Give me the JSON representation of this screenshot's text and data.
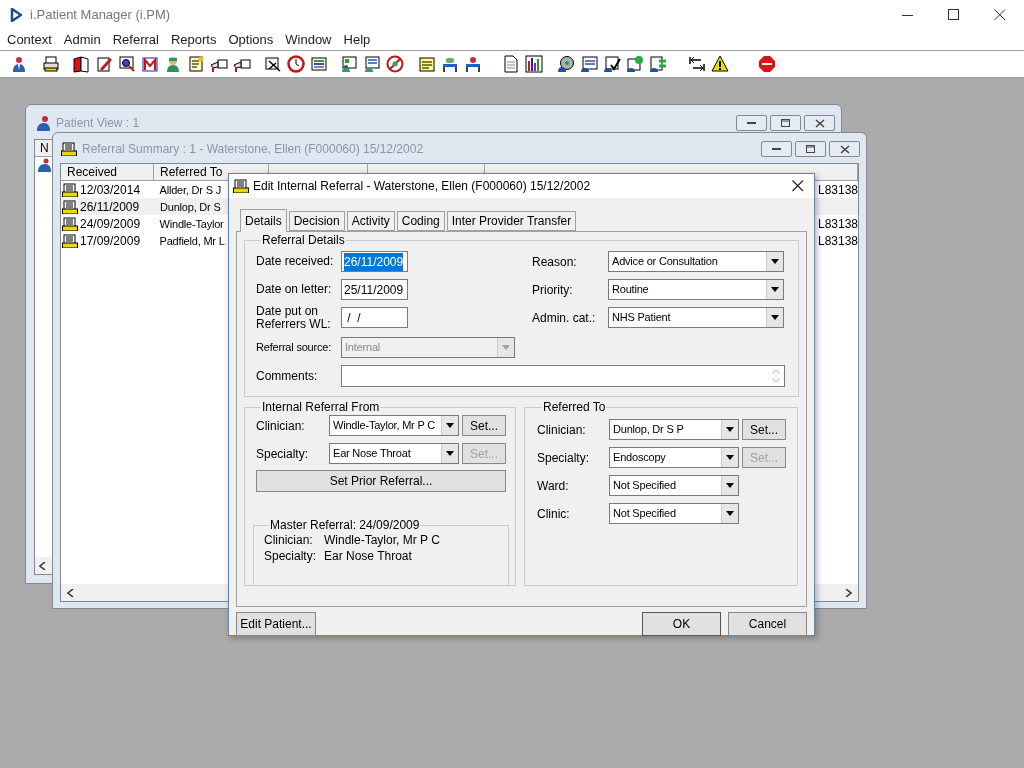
{
  "app": {
    "title": "i.Patient Manager (i.PM)"
  },
  "menu": [
    "Context",
    "Admin",
    "Referral",
    "Reports",
    "Options",
    "Window",
    "Help"
  ],
  "patient_view": {
    "title": "Patient View : 1",
    "column_1": "N"
  },
  "referral_summary": {
    "title": "Referral Summary : 1 - Waterstone, Ellen (F000060) 15/12/2002",
    "columns": [
      "Received",
      "Referred To"
    ],
    "rows": [
      {
        "received": "12/03/2014",
        "referred_to": "Allder, Dr S J",
        "health_org": "L83138",
        "selected": false
      },
      {
        "received": "26/11/2009",
        "referred_to": "Dunlop, Dr S",
        "selected": true
      },
      {
        "received": "24/09/2009",
        "referred_to": "Windle-Taylor",
        "health_org": "L83138",
        "selected": false
      },
      {
        "received": "17/09/2009",
        "referred_to": "Padfield, Mr L",
        "health_org": "L83138",
        "selected": false
      }
    ]
  },
  "dialog": {
    "title": "Edit Internal Referral - Waterstone, Ellen (F000060) 15/12/2002",
    "tabs": [
      {
        "label": "Details",
        "selected": true
      },
      {
        "label": "Decision",
        "selected": false
      },
      {
        "label": "Activity",
        "selected": false
      },
      {
        "label": "Coding",
        "selected": false
      },
      {
        "label": "Inter Provider Transfer",
        "selected": false
      }
    ],
    "referral_details": {
      "label": "Referral Details",
      "dates": [
        {
          "label": "Date received:",
          "value": "26/11/2009",
          "highlighted": true
        },
        {
          "label": "Date on letter:",
          "value": "25/11/2009",
          "highlighted": false
        },
        {
          "label": "Date put on Referrers WL:",
          "value": " /  /",
          "highlighted": false
        }
      ],
      "combos": [
        {
          "label": "Reason:",
          "value": "Advice or Consultation"
        },
        {
          "label": "Priority:",
          "value": "Routine"
        },
        {
          "label": "Admin. cat.:",
          "value": "NHS Patient"
        }
      ],
      "source": {
        "label": "Referral source:",
        "value": "Internal",
        "disabled": true
      },
      "comments": {
        "label": "Comments:"
      }
    },
    "from": {
      "label": "Internal Referral From",
      "rows": [
        {
          "label": "Clinician:",
          "value": "Windle-Taylor, Mr P C",
          "button": {
            "label": "Set...",
            "disabled": false
          }
        },
        {
          "label": "Specialty:",
          "value": "Ear Nose Throat",
          "button": {
            "label": "Set...",
            "disabled": true
          }
        }
      ],
      "prior_button": "Set Prior Referral...",
      "master": {
        "label": "Master Referral: 24/09/2009",
        "rows": [
          {
            "label": "Clinician:",
            "value": "Windle-Taylor, Mr P C"
          },
          {
            "label": "Specialty:",
            "value": "Ear Nose Throat"
          }
        ]
      }
    },
    "to": {
      "label": "Referred To",
      "rows": [
        {
          "label": "Clinician:",
          "value": "Dunlop, Dr S P",
          "button": {
            "label": "Set...",
            "disabled": false
          }
        },
        {
          "label": "Specialty:",
          "value": "Endoscopy",
          "button": {
            "label": "Set...",
            "disabled": true
          }
        },
        {
          "label": "Ward:",
          "value": "Not Specified"
        },
        {
          "label": "Clinic:",
          "value": "Not Specified"
        }
      ]
    },
    "buttons": {
      "edit": "Edit Patient...",
      "ok": "OK",
      "cancel": "Cancel"
    }
  }
}
